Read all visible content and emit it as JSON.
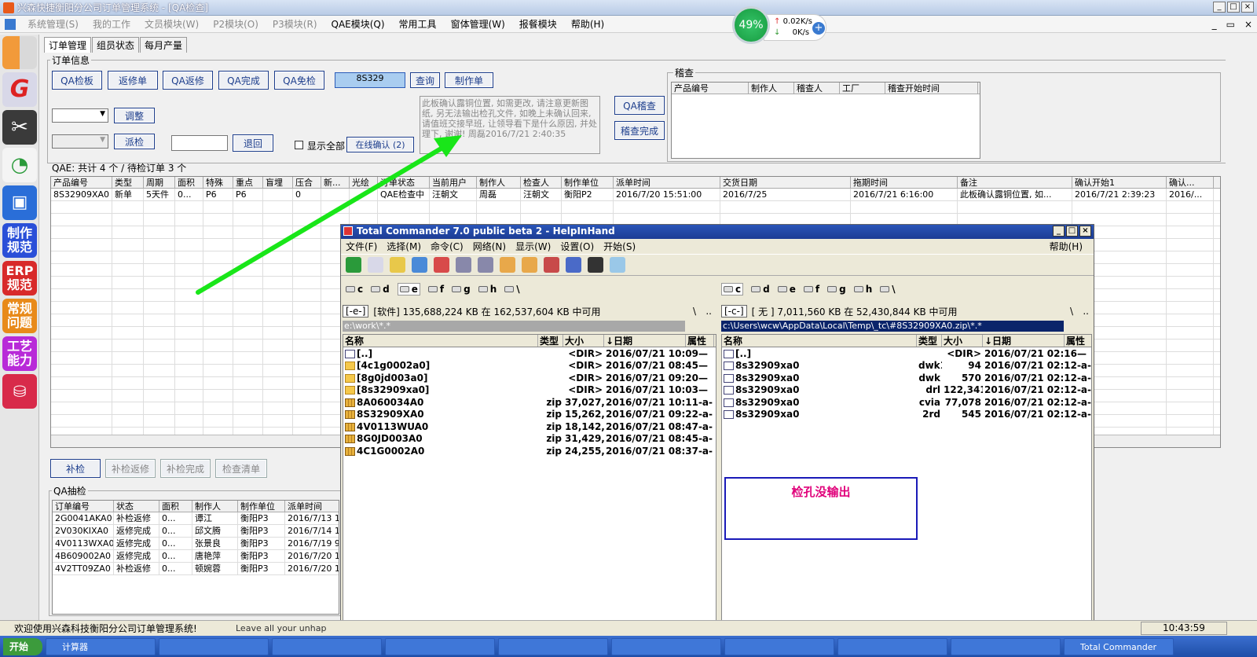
{
  "window": {
    "title": "兴森快捷衡阳分公司订单管理系统 - [QA检查]",
    "min": "_",
    "max": "□",
    "close": "×",
    "restore": "▭"
  },
  "menu": [
    {
      "label": "系统管理(S)",
      "dis": true
    },
    {
      "label": "我的工作",
      "dis": true
    },
    {
      "label": "文员模块(W)",
      "dis": true
    },
    {
      "label": "P2模块(O)",
      "dis": true
    },
    {
      "label": "P3模块(R)",
      "dis": true
    },
    {
      "label": "QAE模块(Q)",
      "dis": false
    },
    {
      "label": "常用工具",
      "dis": false
    },
    {
      "label": "窗体管理(W)",
      "dis": false
    },
    {
      "label": "报餐模块",
      "dis": false
    },
    {
      "label": "帮助(H)",
      "dis": false
    }
  ],
  "net": {
    "percent": "49%",
    "up": "0.02K/s",
    "down": "0K/s",
    "plus": "+"
  },
  "sidebar": {
    "items": [
      "制作规范",
      "ERP规范",
      "常规问题",
      "工艺能力"
    ]
  },
  "tabs": [
    "订单管理",
    "组员状态",
    "每月产量"
  ],
  "order_info": {
    "label": "订单信息",
    "buttons": {
      "qa_board": "QA检板",
      "return_repair": "返修单",
      "qa_return": "QA返修",
      "qa_done": "QA完成",
      "qa_exempt": "QA免检",
      "query": "查询",
      "make_order": "制作单",
      "adjust": "调整",
      "dispatch": "派检",
      "retreat": "退回",
      "online_confirm": "在线确认 (2)",
      "qa_audit": "QA稽查",
      "audit_done": "稽查完成"
    },
    "order_no": "8S329",
    "show_all": "显示全部",
    "note": "此板确认露铜位置, 如需更改, 请注意更新图纸, 另无法输出检孔文件, 如晚上未确认回来, 请值班交接早班, 让领导看下是什么原因, 并处理下, 谢谢! 周磊2016/7/21 2:40:35"
  },
  "audit": {
    "label": "稽查",
    "columns": [
      "产品编号",
      "制作人",
      "稽查人",
      "工厂",
      "稽查开始时间"
    ]
  },
  "qae": {
    "summary": "QAE: 共计 4 个 / 待检订单 3 个",
    "columns": [
      "产品编号",
      "类型",
      "周期",
      "面积",
      "特殊",
      "重点",
      "盲埋",
      "压合",
      "新...",
      "光绘",
      "订单状态",
      "当前用户",
      "制作人",
      "检查人",
      "制作单位",
      "派单时间",
      "交货日期",
      "拖期时间",
      "备注",
      "确认开始1",
      "确认..."
    ],
    "rows": [
      [
        "8S32909XA0",
        "新单",
        "5天件",
        "0...",
        "P6",
        "P6",
        "",
        "0",
        "",
        "",
        "QAE检查中",
        "汪朝文",
        "周磊",
        "汪朝文",
        "衡阳P2",
        "2016/7/20 15:51:00",
        "2016/7/25",
        "2016/7/21 6:16:00",
        "此板确认露铜位置, 如...",
        "2016/7/21 2:39:23",
        "2016/..."
      ]
    ]
  },
  "bottom_buttons": {
    "recheck": "补检",
    "recheck_return": "补检返修",
    "recheck_done": "补检完成",
    "check_list": "检查清单"
  },
  "qa_sample": {
    "label": "QA抽检",
    "columns": [
      "订单编号",
      "状态",
      "面积",
      "制作人",
      "制作单位",
      "派单时间"
    ],
    "rows": [
      [
        "2G0041AKA0",
        "补检返修",
        "0...",
        "谭江",
        "衡阳P3",
        "2016/7/13 1"
      ],
      [
        "2V030KIXA0",
        "返修完成",
        "0...",
        "邱文腾",
        "衡阳P3",
        "2016/7/14 1"
      ],
      [
        "4V0113WXA0",
        "返修完成",
        "0...",
        "张景良",
        "衡阳P3",
        "2016/7/19 9"
      ],
      [
        "4B609002A0",
        "返修完成",
        "0...",
        "唐艳萍",
        "衡阳P3",
        "2016/7/20 1"
      ],
      [
        "4V2TT09ZA0",
        "补检返修",
        "0...",
        "顿婉蓉",
        "衡阳P3",
        "2016/7/20 1"
      ]
    ]
  },
  "tc": {
    "title": "Total Commander 7.0 public beta 2 - HelpInHand",
    "menu": [
      "文件(F)",
      "选择(M)",
      "命令(C)",
      "网络(N)",
      "显示(W)",
      "设置(O)",
      "开始(S)"
    ],
    "help": "帮助(H)",
    "drives": [
      "c",
      "d",
      "e",
      "f",
      "g",
      "h",
      "\\"
    ],
    "left": {
      "drive": "[-e-]",
      "info": "[软件]  135,688,224 KB 在 162,537,604 KB 中可用",
      "path": "e:\\work\\*.*",
      "cols": [
        "名称",
        "类型",
        "大小",
        "↓日期",
        "属性"
      ],
      "rows": [
        {
          "n": "[..]",
          "t": "",
          "s": "<DIR>",
          "d": "2016/07/21 10:09—",
          "i": "up"
        },
        {
          "n": "[4c1g0002a0]",
          "t": "",
          "s": "<DIR>",
          "d": "2016/07/21 08:45—",
          "i": "folder"
        },
        {
          "n": "[8g0jd003a0]",
          "t": "",
          "s": "<DIR>",
          "d": "2016/07/21 09:20—",
          "i": "folder"
        },
        {
          "n": "[8s32909xa0]",
          "t": "",
          "s": "<DIR>",
          "d": "2016/07/21 10:03—",
          "i": "folder"
        },
        {
          "n": "8A060034A0",
          "t": "zip",
          "s": "37,027,795",
          "d": "2016/07/21 10:11-a-",
          "i": "zip"
        },
        {
          "n": "8S32909XA0",
          "t": "zip",
          "s": "15,262,356",
          "d": "2016/07/21 09:22-a-",
          "i": "zip"
        },
        {
          "n": "4V0113WUA0",
          "t": "zip",
          "s": "18,142,222",
          "d": "2016/07/21 08:47-a-",
          "i": "zip"
        },
        {
          "n": "8G0JD003A0",
          "t": "zip",
          "s": "31,429,268",
          "d": "2016/07/21 08:45-a-",
          "i": "zip"
        },
        {
          "n": "4C1G0002A0",
          "t": "zip",
          "s": "24,255,173",
          "d": "2016/07/21 08:37-a-",
          "i": "zip"
        }
      ]
    },
    "right": {
      "drive": "[-c-]",
      "info": "[ 无 ]  7,011,560 KB 在 52,430,844 KB 中可用",
      "path": "c:\\Users\\wcw\\AppData\\Local\\Temp\\_tc\\#8S32909XA0.zip\\*.*",
      "cols": [
        "名称",
        "类型",
        "大小",
        "↓日期",
        "属性"
      ],
      "rows": [
        {
          "n": "[..]",
          "t": "",
          "s": "<DIR>",
          "d": "2016/07/21 02:16—",
          "i": "up"
        },
        {
          "n": "8s32909xa0",
          "t": "dwk1",
          "s": "94",
          "d": "2016/07/21 02:12-a-",
          "i": "doc"
        },
        {
          "n": "8s32909xa0",
          "t": "dwk",
          "s": "570",
          "d": "2016/07/21 02:12-a-",
          "i": "doc"
        },
        {
          "n": "8s32909xa0",
          "t": "drl",
          "s": "122,341",
          "d": "2016/07/21 02:12-a-",
          "i": "doc"
        },
        {
          "n": "8s32909xa0",
          "t": "cvia",
          "s": "77,078",
          "d": "2016/07/21 02:12-a-",
          "i": "doc"
        },
        {
          "n": "8s32909xa0",
          "t": "2rd",
          "s": "545",
          "d": "2016/07/21 02:12-a-",
          "i": "doc"
        }
      ]
    },
    "annotation": "检孔没输出"
  },
  "status": {
    "welcome": "欢迎使用兴森科技衡阳分公司订单管理系统!",
    "msg": "Leave all your unhap",
    "time": "10:43:59"
  },
  "taskbar": {
    "start": "开始",
    "items": [
      "计算器",
      "",
      "",
      "",
      "",
      "",
      "",
      "",
      "",
      "Total Commander"
    ]
  },
  "colors": {
    "arrow": "#19e619",
    "annotation_border": "#1a1ab8",
    "annotation_text": "#e0007a"
  }
}
